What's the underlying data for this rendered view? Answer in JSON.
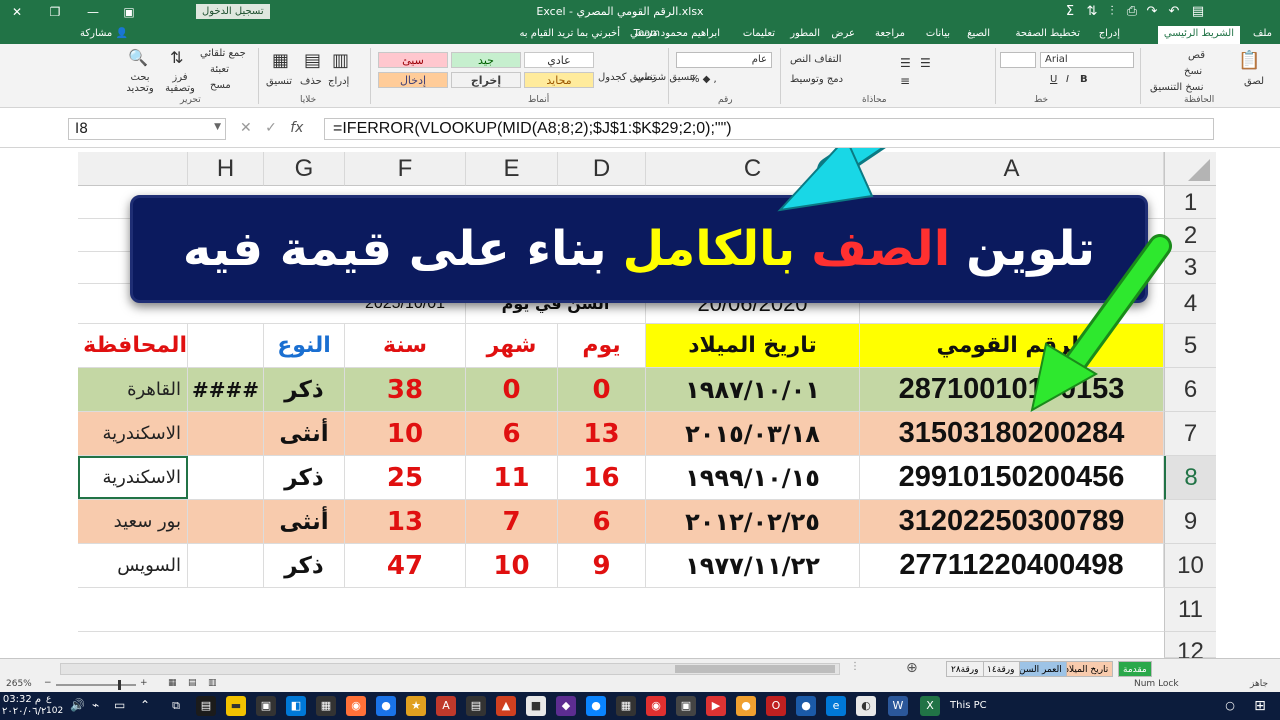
{
  "titlebar": {
    "title": "Excel - الرقم القومي المصري.xlsx",
    "signin": "تسجيل الدخول",
    "share": "مشاركة"
  },
  "tabs": [
    {
      "label": "ملف"
    },
    {
      "label": "الشريط الرئيسي"
    },
    {
      "label": "إدراج"
    },
    {
      "label": "تخطيط الصفحة"
    },
    {
      "label": "الصيغ"
    },
    {
      "label": "بيانات"
    },
    {
      "label": "مراجعة"
    },
    {
      "label": "عرض"
    },
    {
      "label": "المطور"
    },
    {
      "label": "تعليمات"
    },
    {
      "label": "ابراهيم محمود مرسي"
    },
    {
      "label": "Team"
    },
    {
      "label": "أخبرني بما تريد القيام به"
    }
  ],
  "ribbon": {
    "clipboard": {
      "paste": "لصق",
      "cut": "قص",
      "copy": "نسخ",
      "format_painter": "نسخ التنسيق",
      "group": "الحافظة"
    },
    "font": {
      "name": "Arial",
      "group": "خط"
    },
    "alignment": {
      "wrap": "التفاف النص",
      "merge": "دمج وتوسيط",
      "group": "محاذاة"
    },
    "number": {
      "format": "عام",
      "group": "رقم"
    },
    "styles": {
      "conditional": "تنسيق شرطي",
      "table": "تنسيق كجدول",
      "normal": "عادي",
      "bad": "سيئ",
      "good": "جيد",
      "neutral": "محايد",
      "input": "إدخال",
      "output": "إخراج",
      "group": "أنماط"
    },
    "cells": {
      "insert": "إدراج",
      "delete": "حذف",
      "format": "تنسيق",
      "group": "خلايا"
    },
    "editing": {
      "autosum": "جمع تلقائي",
      "fill": "تعبئة",
      "clear": "مسح",
      "sort": "فرز وتصفية",
      "find": "بحث وتحديد",
      "group": "تحرير"
    }
  },
  "formula_bar": {
    "name_box": "I8",
    "formula": "=IFERROR(VLOOKUP(MID(A8;8;2);$J$1:$K$29;2;0);\"\")"
  },
  "columns": [
    "A",
    "C",
    "D",
    "E",
    "F",
    "G",
    "H"
  ],
  "row_numbers": [
    "1",
    "2",
    "3",
    "4",
    "5",
    "6",
    "7",
    "8",
    "9",
    "10",
    "11",
    "12"
  ],
  "row4": {
    "date": "20/06/2020",
    "age_label": "السن في يوم",
    "ref_date": "2025/10/01"
  },
  "headers": {
    "national_id": "الرقم القومي",
    "birth_date": "تاريخ الميلاد",
    "day": "يوم",
    "month": "شهر",
    "year": "سنة",
    "gender": "النوع",
    "governorate": "المحافظة"
  },
  "rows": [
    {
      "id": "28710010100153",
      "birth": "١٩٨٧/١٠/٠١",
      "day": "0",
      "month": "0",
      "year": "38",
      "gender": "ذكر",
      "h": "####",
      "city": "القاهرة"
    },
    {
      "id": "31503180200284",
      "birth": "٢٠١٥/٠٣/١٨",
      "day": "13",
      "month": "6",
      "year": "10",
      "gender": "أنثى",
      "h": "",
      "city": "الاسكندرية"
    },
    {
      "id": "29910150200456",
      "birth": "١٩٩٩/١٠/١٥",
      "day": "16",
      "month": "11",
      "year": "25",
      "gender": "ذكر",
      "h": "",
      "city": "الاسكندرية"
    },
    {
      "id": "31202250300789",
      "birth": "٢٠١٢/٠٢/٢٥",
      "day": "6",
      "month": "7",
      "year": "13",
      "gender": "أنثى",
      "h": "",
      "city": "بور سعيد"
    },
    {
      "id": "27711220400498",
      "birth": "١٩٧٧/١١/٢٢",
      "day": "9",
      "month": "10",
      "year": "47",
      "gender": "ذكر",
      "h": "",
      "city": "السويس"
    }
  ],
  "banner": {
    "word1": "تلوين",
    "word2": "الصف",
    "word3": "بالكامل",
    "word4": "بناء على قيمة فيه"
  },
  "sheet_tabs": [
    "مقدمة",
    "تاريخ الميلاد",
    "العمر السن",
    "ورقة١٤",
    "ورقة٢٨"
  ],
  "status": {
    "ready": "جاهز",
    "numlock": "Num Lock",
    "zoom": "265%"
  },
  "taskbar": {
    "this_pc": "This PC",
    "time": "03:32 م",
    "date": "٢٠٢٠/٠٦/٢٠",
    "lang": "ع",
    "count": "102"
  },
  "colors": {
    "excel_green": "#217346",
    "row_green": "#c4d7a4",
    "row_peach": "#f8cbad",
    "header_yellow": "#ffff00",
    "banner_navy": "#0b1a5e",
    "banner_yellow": "#ffff00",
    "banner_red": "#ff3030",
    "arrow_cyan": "#19d7e6",
    "arrow_green": "#2ee82e"
  }
}
